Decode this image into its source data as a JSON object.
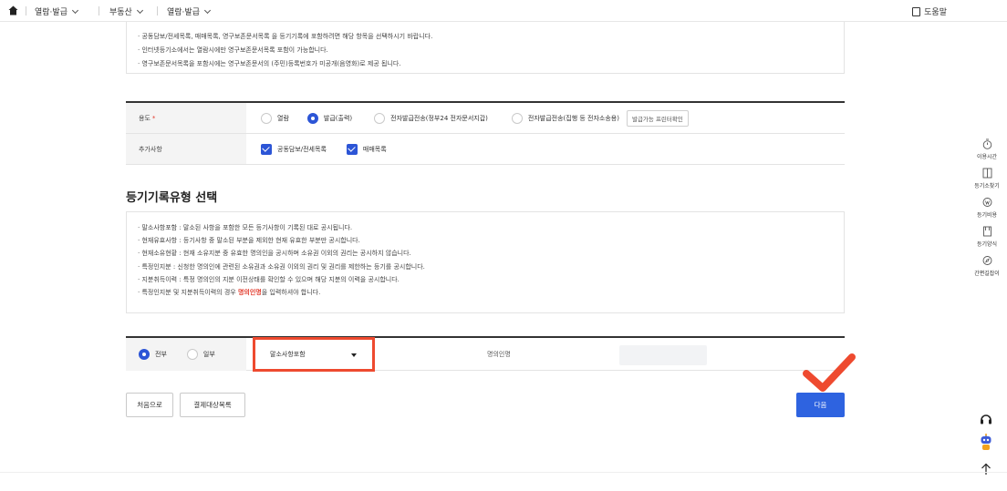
{
  "nav": {
    "items": [
      "열람·발급",
      "부동산",
      "열람·발급"
    ],
    "help": "도움말"
  },
  "notice": {
    "lines": [
      "· 공동담보/전세목록, 매매목록, 영구보존문서목록 을 등기기록에 포함하려면 해당 항목을 선택하시기 바랍니다.",
      "· 인터넷등기소에서는 열람시에만 영구보존문서목록 포함이 가능합니다.",
      "· 영구보존문서목록을 포함시에는 영구보존문서의 (주민)등록번호가 미공개(음영화)로 제공 됩니다."
    ]
  },
  "form": {
    "usage": {
      "label": "용도",
      "required_mark": "*",
      "options": [
        "열람",
        "발급(출력)",
        "전자발급전송(정부24 전자문서지갑)",
        "전자발급전송(집행 등 전자소송용)"
      ],
      "selected": "발급(출력)",
      "printer_button": "발급가능 프린터확인"
    },
    "extra": {
      "label": "추가사항",
      "options": [
        "공동담보/전세목록",
        "매매목록"
      ]
    }
  },
  "section": {
    "title": "등기기록유형 선택"
  },
  "notice2": {
    "lines": [
      "· 말소사항포함 : 말소된 사항을 포함한 모든 등기사항이 기록된 대로 공시됩니다.",
      "· 현재유효사항 : 등기사항 중 말소된 부분을 제외한 현재 유효한 부분만 공시합니다.",
      "· 현재소유현황 : 현재 소유지분 중 유효한 명의인을 공시하며 소유권 이외의 권리는 공시하지 않습니다.",
      "· 특정인지분 : 신청한 명의인에 관련된 소유권과 소유권 이외의 권리 및 권리를 제한하는 등기를 공시합니다.",
      "· 지분취득이력 : 특정 명의인의 지분 이전상태를 확인할 수 있으며 해당 지분의 이력을 공시합니다."
    ],
    "last_prefix": "· 특정인지분 및 지분취득이력의 경우 ",
    "last_highlight": "명의인명",
    "last_suffix": "을 입력하셔야 합니다."
  },
  "record_type": {
    "scope_options": [
      "전부",
      "일부"
    ],
    "scope_selected": "전부",
    "dropdown_value": "말소사항포함",
    "owner_label": "명의인명",
    "owner_value": ""
  },
  "buttons": {
    "home": "처음으로",
    "payment_list": "결제대상목록",
    "next": "다음"
  },
  "rail": {
    "items": [
      "이용시간",
      "등기소찾기",
      "등기비용",
      "등기양식",
      "간편길잡이"
    ]
  },
  "colors": {
    "accent": "#2e63e0",
    "highlight_border": "#ee4a2f",
    "checkmark": "#ee4a2f"
  }
}
